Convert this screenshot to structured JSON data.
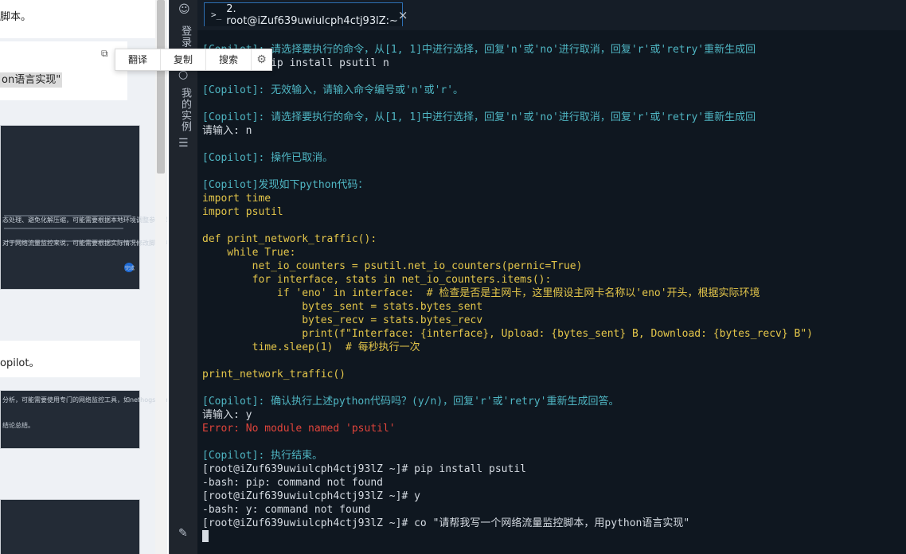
{
  "left_pane": {
    "top_text": "脚本。",
    "highlight_text": "on语言实现\"",
    "bottom_text": "opilot。",
    "shot1_caption": "态处理、避免化解压缩，可能需要根据本地环境调整参数以及依赖库 'netutils' 或者 'logging' 安装",
    "shot1_caption2": "对于网络流量监控来说，可能需要根据实际情况修改脚本中的接口名称",
    "shot1_badge": "完成",
    "shot2_caption": "分析，可能需要使用专门的网络监控工具，如nethogs或vnstat等",
    "shot2_caption2": "结论总结。"
  },
  "popup": {
    "translate": "翻译",
    "copy": "复制",
    "search": "搜索",
    "gear_icon": "gear-icon"
  },
  "activity_bar": {
    "login": "登录",
    "my_instances": "我的实例"
  },
  "terminal": {
    "tab_title": "2. root@iZuf639uwiulcph4ctj93lZ:~",
    "tab_prompt_icon": ">_",
    "close_icon": "×",
    "lines": [
      {
        "t": "[Copilot]: 请选择要执行的命令，从[1, 1]中进行选择，回复'n'或'no'进行取消，回复'r'或'retry'重新生成回",
        "c": "copilot"
      },
      {
        "t": "          pip install psutil n",
        "c": "norm"
      },
      {
        "t": "",
        "c": "norm"
      },
      {
        "t": "[Copilot]: 无效输入，请输入命令编号或'n'或'r'。",
        "c": "copilot"
      },
      {
        "t": "",
        "c": "norm"
      },
      {
        "t": "[Copilot]: 请选择要执行的命令，从[1, 1]中进行选择，回复'n'或'no'进行取消，回复'r'或'retry'重新生成回",
        "c": "copilot"
      },
      {
        "t": "请输入: n",
        "c": "norm"
      },
      {
        "t": "",
        "c": "norm"
      },
      {
        "t": "[Copilot]: 操作已取消。",
        "c": "copilot"
      },
      {
        "t": "",
        "c": "norm"
      },
      {
        "t": "[Copilot]发现如下python代码：",
        "c": "copilot"
      },
      {
        "t": "import time",
        "c": "code"
      },
      {
        "t": "import psutil",
        "c": "code"
      },
      {
        "t": "",
        "c": "norm"
      },
      {
        "t": "def print_network_traffic():",
        "c": "code"
      },
      {
        "t": "    while True:",
        "c": "code"
      },
      {
        "t": "        net_io_counters = psutil.net_io_counters(pernic=True)",
        "c": "code"
      },
      {
        "t": "        for interface, stats in net_io_counters.items():",
        "c": "code"
      },
      {
        "t": "            if 'eno' in interface:  # 检查是否是主网卡，这里假设主网卡名称以'eno'开头，根据实际环境",
        "c": "code"
      },
      {
        "t": "                bytes_sent = stats.bytes_sent",
        "c": "code"
      },
      {
        "t": "                bytes_recv = stats.bytes_recv",
        "c": "code"
      },
      {
        "t": "                print(f\"Interface: {interface}, Upload: {bytes_sent} B, Download: {bytes_recv} B\")",
        "c": "code"
      },
      {
        "t": "        time.sleep(1)  # 每秒执行一次",
        "c": "code"
      },
      {
        "t": "",
        "c": "norm"
      },
      {
        "t": "print_network_traffic()",
        "c": "code"
      },
      {
        "t": "",
        "c": "norm"
      },
      {
        "t": "[Copilot]: 确认执行上述python代码吗？(y/n)，回复'r'或'retry'重新生成回答。",
        "c": "copilot"
      },
      {
        "t": "请输入: y",
        "c": "norm"
      },
      {
        "t": "Error: No module named 'psutil'",
        "c": "err"
      },
      {
        "t": "",
        "c": "norm"
      },
      {
        "t": "[Copilot]: 执行结束。",
        "c": "copilot"
      },
      {
        "t": "[root@iZuf639uwiulcph4ctj93lZ ~]# pip install psutil",
        "c": "norm"
      },
      {
        "t": "-bash: pip: command not found",
        "c": "norm"
      },
      {
        "t": "[root@iZuf639uwiulcph4ctj93lZ ~]# y",
        "c": "norm"
      },
      {
        "t": "-bash: y: command not found",
        "c": "norm"
      },
      {
        "t": "[root@iZuf639uwiulcph4ctj93lZ ~]# co \"请帮我写一个网络流量监控脚本，用python语言实现\"",
        "c": "norm"
      }
    ]
  },
  "colors": {
    "terminal_bg": "#0f1720",
    "copilot": "#4fb6c3",
    "code": "#e4c64a",
    "error": "#e0443b",
    "tab_border": "#2d6fb3"
  }
}
